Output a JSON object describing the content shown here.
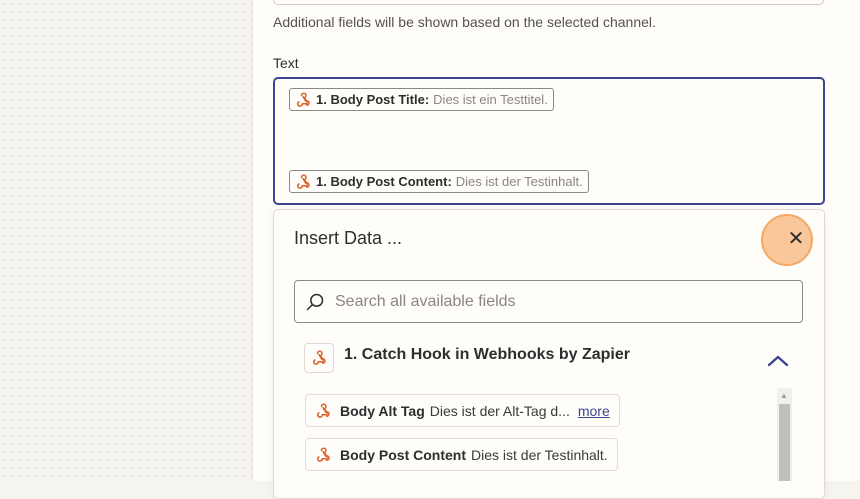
{
  "form": {
    "helper_text": "Additional fields will be shown based on the selected channel.",
    "text_label": "Text",
    "text_value_tokens": [
      {
        "key": "1. Body Post Title:",
        "value": "Dies ist ein Testtitel."
      },
      {
        "key": "1. Body Post Content:",
        "value": "Dies ist der Testinhalt."
      }
    ]
  },
  "insert_data": {
    "title": "Insert Data ...",
    "close_glyph": "✕",
    "search_placeholder": "Search all available fields",
    "step": {
      "title": "1. Catch Hook in Webhooks by Zapier",
      "icon": "webhook-icon",
      "expanded": true
    },
    "fields": [
      {
        "key": "Body Alt Tag",
        "value": "Dies ist der Alt-Tag d...",
        "more_label": "more"
      },
      {
        "key": "Body Post Content",
        "value": "Dies ist der Testinhalt."
      }
    ]
  },
  "colors": {
    "accent": "#3d4592",
    "webhook_orange": "#d9622b",
    "close_highlight": "#f9c79a"
  }
}
